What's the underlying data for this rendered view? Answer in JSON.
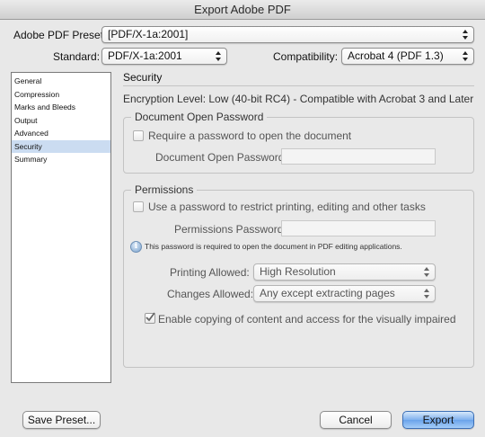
{
  "window": {
    "title": "Export Adobe PDF"
  },
  "preset": {
    "label": "Adobe PDF Preset:",
    "value": "[PDF/X-1a:2001]"
  },
  "standard": {
    "label": "Standard:",
    "value": "PDF/X-1a:2001"
  },
  "compatibility": {
    "label": "Compatibility:",
    "value": "Acrobat 4 (PDF 1.3)"
  },
  "sidebar": {
    "items": [
      {
        "label": "General"
      },
      {
        "label": "Compression"
      },
      {
        "label": "Marks and Bleeds"
      },
      {
        "label": "Output"
      },
      {
        "label": "Advanced"
      },
      {
        "label": "Security"
      },
      {
        "label": "Summary"
      }
    ],
    "selected": "Security"
  },
  "security": {
    "title": "Security",
    "encryption": "Encryption Level: Low (40-bit RC4) - Compatible with Acrobat 3 and Later",
    "open_password": {
      "group_title": "Document Open Password",
      "require_label": "Require a password to open the document",
      "require_checked": false,
      "field_label": "Document Open Password:",
      "field_value": ""
    },
    "permissions": {
      "group_title": "Permissions",
      "restrict_label": "Use a password to restrict printing, editing and other tasks",
      "restrict_checked": false,
      "field_label": "Permissions Password:",
      "field_value": "",
      "info_note": "This password is required to open the document in PDF editing applications.",
      "printing_label": "Printing Allowed:",
      "printing_value": "High Resolution",
      "changes_label": "Changes Allowed:",
      "changes_value": "Any except extracting pages",
      "copy_label": "Enable copying of content and access for the visually impaired",
      "copy_checked": true
    }
  },
  "buttons": {
    "save_preset": "Save Preset...",
    "cancel": "Cancel",
    "export": "Export"
  },
  "colors": {
    "selection": "#cbdcf1",
    "default_button": "#6aa3ea"
  }
}
